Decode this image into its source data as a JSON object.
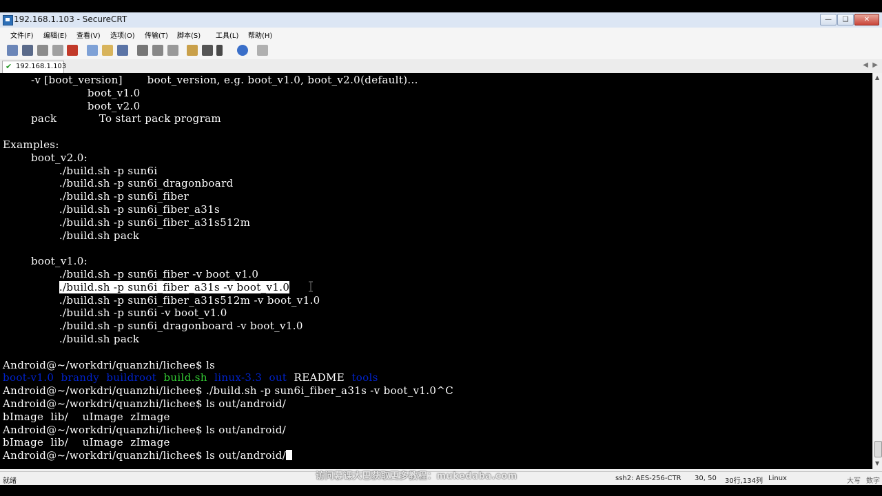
{
  "window": {
    "title": "192.168.1.103 - SecureCRT"
  },
  "menu": [
    "文件(F)",
    "编辑(E)",
    "查看(V)",
    "选项(O)",
    "传输(T)",
    "脚本(S)",
    "工具(L)",
    "帮助(H)"
  ],
  "toolbar_icons": [
    "connect-icon",
    "quick-connect-icon",
    "connect-tab-icon",
    "reconnect-icon",
    "disconnect-icon",
    "copy-icon",
    "paste-icon",
    "find-icon",
    "print-icon",
    "print-selection-icon",
    "print-setup-icon",
    "session-options-icon",
    "global-options-icon",
    "keymap-icon",
    "help-icon",
    "log-icon"
  ],
  "tab": {
    "label": "192.168.1.103"
  },
  "terminal": {
    "lines": [
      "        -v [boot_version]       boot_version, e.g. boot_v1.0, boot_v2.0(default)...",
      "                        boot_v1.0",
      "                        boot_v2.0",
      "        pack            To start pack program",
      "",
      "Examples:",
      "        boot_v2.0:",
      "                ./build.sh -p sun6i",
      "                ./build.sh -p sun6i_dragonboard",
      "                ./build.sh -p sun6i_fiber",
      "                ./build.sh -p sun6i_fiber_a31s",
      "                ./build.sh -p sun6i_fiber_a31s512m",
      "                ./build.sh pack",
      "",
      "        boot_v1.0:",
      "                ./build.sh -p sun6i_fiber -v boot_v1.0",
      "HIGHLIGHT",
      "                ./build.sh -p sun6i_fiber_a31s512m -v boot_v1.0",
      "                ./build.sh -p sun6i -v boot_v1.0",
      "                ./build.sh -p sun6i_dragonboard -v boot_v1.0",
      "                ./build.sh pack",
      "",
      "Android@~/workdri/quanzhi/lichee$ ls",
      "LSCOLORS",
      "Android@~/workdri/quanzhi/lichee$ ./build.sh -p sun6i_fiber_a31s -v boot_v1.0^C",
      "Android@~/workdri/quanzhi/lichee$ ls out/android/",
      "bImage  lib/    uImage  zImage",
      "Android@~/workdri/quanzhi/lichee$ ls out/android/",
      "bImage  lib/    uImage  zImage",
      "PROMPT"
    ],
    "highlighted_line": {
      "indent": "                ",
      "text": "./build.sh -p sun6i_fiber_a31s -v boot_v1.0"
    },
    "ls_output": [
      {
        "name": "boot-v1.0",
        "color": "#0022cc"
      },
      {
        "name": "brandy",
        "color": "#0022cc"
      },
      {
        "name": "buildroot",
        "color": "#0022cc"
      },
      {
        "name": "build.sh",
        "color": "#33cc33"
      },
      {
        "name": "linux-3.3",
        "color": "#0022cc"
      },
      {
        "name": "out",
        "color": "#0022cc"
      },
      {
        "name": "README",
        "color": "#ffffff"
      },
      {
        "name": "tools",
        "color": "#0022cc"
      }
    ],
    "last_prompt": "Android@~/workdri/quanzhi/lichee$ ls out/android/"
  },
  "status": {
    "ready": "就绪",
    "cipher": "ssh2: AES-256-CTR",
    "cursor_pos": "30, 50",
    "size": "30行,134列",
    "os": "Linux",
    "caps": "大写",
    "num": "数字"
  },
  "watermark": "访问慕课大巴获取更多教程：mukedaba.com"
}
